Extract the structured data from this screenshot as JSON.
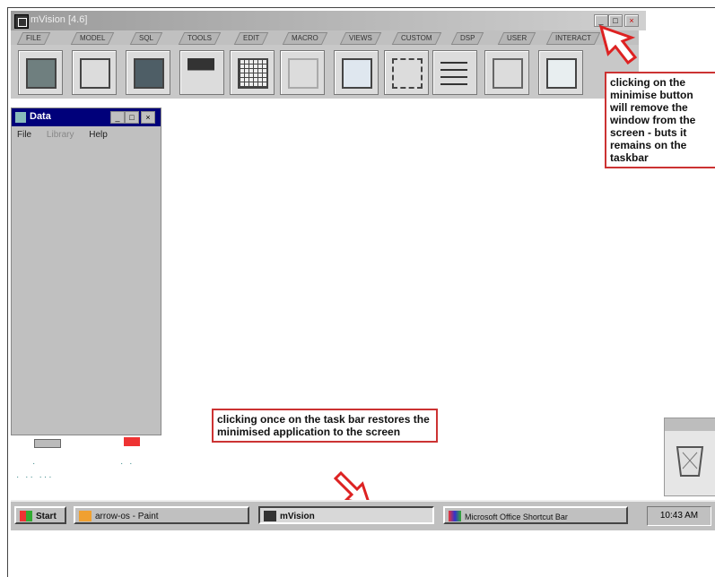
{
  "window": {
    "title": "mVision [4.6]",
    "menu_tabs": [
      "FILE",
      "MODEL",
      "SQL",
      "TOOLS",
      "EDIT",
      "MACRO",
      "VIEWS",
      "CUSTOM",
      "DSP",
      "USER",
      "INTERACT"
    ]
  },
  "data_window": {
    "title": "Data",
    "menu": [
      "File",
      "Library",
      "Help"
    ]
  },
  "callouts": {
    "minimise": "clicking on the minimise button will remove the window from the screen - buts it remains on the taskbar",
    "taskbar": "clicking once on the task bar restores the minimised application to the screen"
  },
  "taskbar": {
    "start_label": "Start",
    "tasks": [
      "arrow-os - Paint",
      "mVision",
      "Microsoft Office Shortcut Bar"
    ],
    "clock": "10:43 AM"
  },
  "colors": {
    "callout_border": "#cc3333",
    "arrow": "#dd2222",
    "data_titlebar": "#00007a"
  }
}
